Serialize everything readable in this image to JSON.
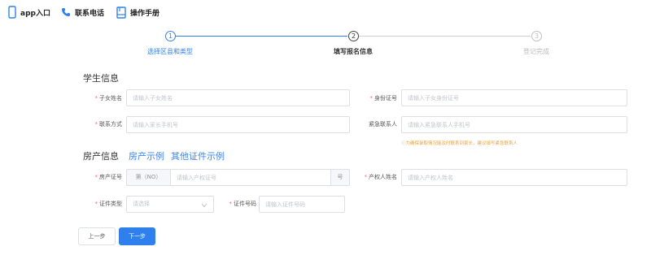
{
  "topbar": {
    "app_entry": "app入口",
    "contact_phone": "联系电话",
    "manual": "操作手册"
  },
  "steps": [
    {
      "number": "1",
      "label": "选择区县和类型",
      "state": "active"
    },
    {
      "number": "2",
      "label": "填写报名信息",
      "state": "current"
    },
    {
      "number": "3",
      "label": "登记完成",
      "state": "pending"
    }
  ],
  "student_section": {
    "title": "学生信息",
    "child_name_label": "子女姓名",
    "child_name_placeholder": "请输入子女姓名",
    "id_number_label": "身份证号",
    "id_number_placeholder": "请输入子女身份证号",
    "contact_label": "联系方式",
    "contact_placeholder": "请输入家长手机号",
    "emergency_label": "紧急联系人",
    "emergency_placeholder": "请输入紧急联系人手机号",
    "hint": "ⓘ为确保录取情况能及时联系到家长，建议填写紧急联系人"
  },
  "property_section": {
    "title": "房产信息",
    "example_link": "房产示例",
    "other_example_link": "其他证件示例",
    "cert_no_label": "房产证号",
    "cert_prefix": "第（NO）",
    "cert_placeholder": "请输入产权证号",
    "cert_suffix": "号",
    "owner_label": "产权人姓名",
    "owner_placeholder": "请输入产权人姓名",
    "doc_type_label": "证件类型",
    "doc_type_placeholder": "请选择",
    "doc_no_label": "证件号码",
    "doc_no_placeholder": "请输入证件号码"
  },
  "buttons": {
    "prev": "上一步",
    "next": "下一步"
  },
  "colors": {
    "accent": "#2f80ed",
    "required": "#f56c6c",
    "hint": "#e6a23c"
  }
}
